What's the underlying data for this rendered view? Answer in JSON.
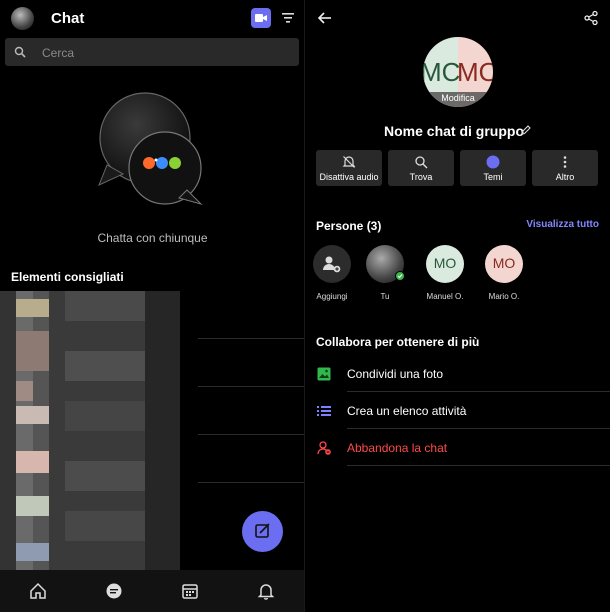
{
  "left_panel": {
    "title": "Chat",
    "search_placeholder": "Cerca",
    "empty_state_text": "Chatta con chiunque",
    "recommended_header": "Elementi consigliati",
    "nav": [
      "home-icon",
      "chat-icon",
      "calendar-icon",
      "bell-icon"
    ],
    "accent_color": "#6b6ef0"
  },
  "right_panel": {
    "avatar_initials_left": "MC",
    "avatar_initials_right": "MO",
    "avatar_edit_label": "Modifica",
    "group_name": "Nome chat di gruppo",
    "actions": [
      {
        "label": "Disattiva audio",
        "icon": "mute-bell-icon"
      },
      {
        "label": "Trova",
        "icon": "search-icon"
      },
      {
        "label": "Temi",
        "icon": "theme-circle-icon"
      },
      {
        "label": "Altro",
        "icon": "more-icon"
      }
    ],
    "people_header": "Persone (3)",
    "see_all": "Visualizza tutto",
    "people": [
      {
        "label": "Aggiungi",
        "initials": ""
      },
      {
        "label": "Tu",
        "initials": ""
      },
      {
        "label": "Manuel O.",
        "initials": "MO"
      },
      {
        "label": "Mario O.",
        "initials": "MO"
      }
    ],
    "collab_header": "Collabora per ottenere di più",
    "collab_items": [
      {
        "label": "Condividi una foto",
        "color": "#ffffff"
      },
      {
        "label": "Crea un elenco attività",
        "color": "#ffffff"
      },
      {
        "label": "Abbandona la chat",
        "color": "#ff4a4a"
      }
    ]
  }
}
